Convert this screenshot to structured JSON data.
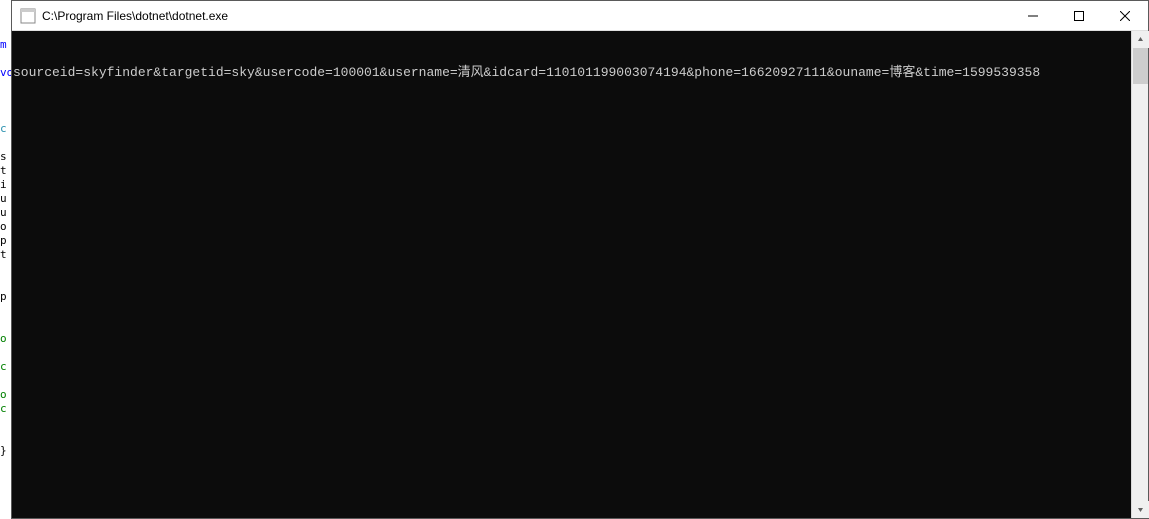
{
  "window": {
    "title": "C:\\Program Files\\dotnet\\dotnet.exe"
  },
  "console": {
    "line1": "sourceid=skyfinder&targetid=sky&usercode=100001&username=清风&idcard=110101199003074194&phone=16620927111&ouname=博客&time=1599539358"
  },
  "left_hints": {
    "h1": "m",
    "h2": "c",
    "h3": "s",
    "h4": "t",
    "h5": "i",
    "h6": "u",
    "h7": "u",
    "h8": "o",
    "h9": "p",
    "h10": "t",
    "h11": "p",
    "h12": "o",
    "h13": "c",
    "h14": "o",
    "h15": "c",
    "h16": "}"
  },
  "colors": {
    "titlebar_bg": "#ffffff",
    "console_bg": "#0c0c0c",
    "console_fg": "#cccccc"
  }
}
